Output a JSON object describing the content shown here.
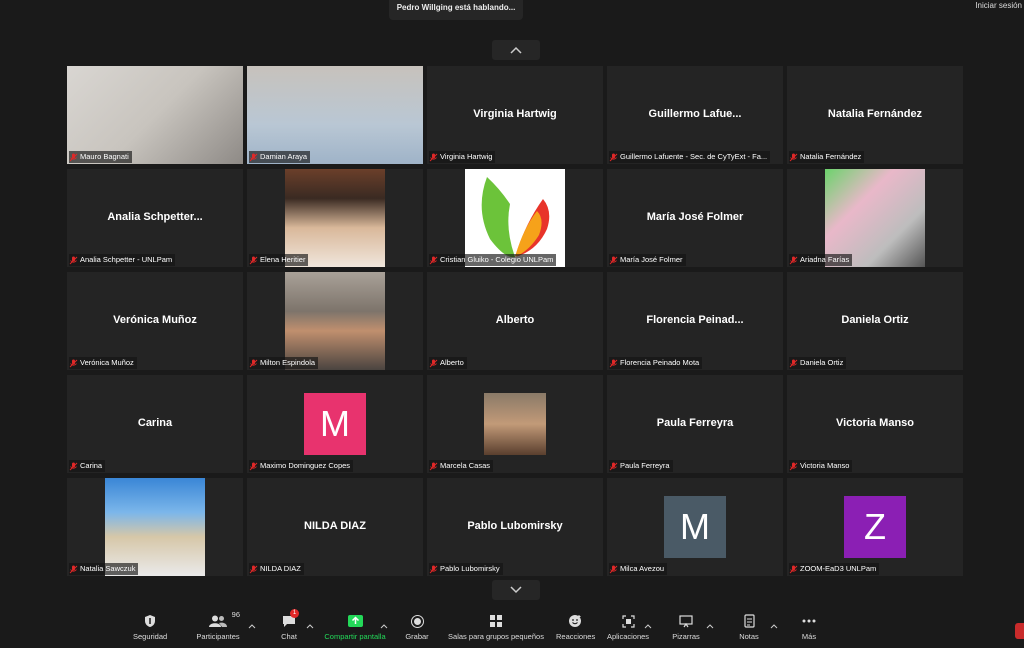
{
  "banner": {
    "speaking": "Pedro Willging está hablando..."
  },
  "signin": "Iniciar sesión",
  "participants": [
    {
      "name": "Mauro Bagnati",
      "display": "",
      "kind": "photo"
    },
    {
      "name": "Damian Araya",
      "display": "",
      "kind": "photo"
    },
    {
      "name": "Virginia Hartwig",
      "display": "Virginia Hartwig",
      "kind": "name"
    },
    {
      "name": "Guillermo Lafuente - Sec. de CyTyExt - Fa...",
      "display": "Guillermo  Lafue...",
      "kind": "name"
    },
    {
      "name": "Natalia Fernández",
      "display": "Natalia Fernández",
      "kind": "name"
    },
    {
      "name": "Analia Schpetter - UNLPam",
      "display": "Analia  Schpetter...",
      "kind": "name"
    },
    {
      "name": "Elena Heritier",
      "display": "",
      "kind": "photo"
    },
    {
      "name": "Cristian Gluiko - Colegio UNLPam",
      "display": "",
      "kind": "logo"
    },
    {
      "name": "María José Folmer",
      "display": "María José Folmer",
      "kind": "name"
    },
    {
      "name": "Ariadna Farías",
      "display": "",
      "kind": "photo"
    },
    {
      "name": "Verónica Muñoz",
      "display": "Verónica Muñoz",
      "kind": "name"
    },
    {
      "name": "Milton Espindola",
      "display": "",
      "kind": "photo"
    },
    {
      "name": "Alberto",
      "display": "Alberto",
      "kind": "name"
    },
    {
      "name": "Florencia Peinado Mota",
      "display": "Florencia  Peinad...",
      "kind": "name"
    },
    {
      "name": "Daniela Ortiz",
      "display": "Daniela Ortiz",
      "kind": "name"
    },
    {
      "name": "Carina",
      "display": "Carina",
      "kind": "name"
    },
    {
      "name": "Maximo Dominguez Copes",
      "display": "",
      "kind": "avatar",
      "letter": "M",
      "color": "#e8336e"
    },
    {
      "name": "Marcela Casas",
      "display": "",
      "kind": "photo"
    },
    {
      "name": "Paula Ferreyra",
      "display": "Paula Ferreyra",
      "kind": "name"
    },
    {
      "name": "Victoria Manso",
      "display": "Victoria Manso",
      "kind": "name"
    },
    {
      "name": "Natalia Sawczuk",
      "display": "",
      "kind": "photo"
    },
    {
      "name": "NILDA DIAZ",
      "display": "NILDA DIAZ",
      "kind": "name"
    },
    {
      "name": "Pablo Lubomirsky",
      "display": "Pablo Lubomirsky",
      "kind": "name"
    },
    {
      "name": "Milca Avezou",
      "display": "",
      "kind": "avatar",
      "letter": "M",
      "color": "#4a5a66"
    },
    {
      "name": "ZOOM-EaD3 UNLPam",
      "display": "",
      "kind": "avatar",
      "letter": "Z",
      "color": "#8b1fb4"
    }
  ],
  "toolbar": {
    "security": "Seguridad",
    "participants": "Participantes",
    "participants_count": "96",
    "chat": "Chat",
    "chat_badge": "1",
    "share": "Compartir pantalla",
    "record": "Grabar",
    "breakout": "Salas para grupos pequeños",
    "reactions": "Reacciones",
    "apps": "Aplicaciones",
    "whiteboard": "Pizarras",
    "notes": "Notas",
    "more": "Más"
  },
  "colors": {
    "share_green": "#23d959",
    "badge_red": "#e02828",
    "muted_red": "#e02828"
  }
}
